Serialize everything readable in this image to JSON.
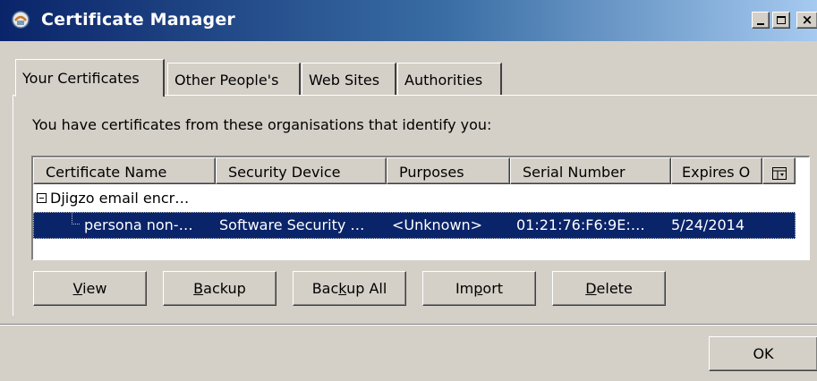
{
  "window": {
    "title": "Certificate Manager",
    "icon": "certificate-manager-app-icon"
  },
  "tabs": [
    {
      "label": "Your Certificates",
      "active": true
    },
    {
      "label": "Other People's",
      "active": false
    },
    {
      "label": "Web Sites",
      "active": false
    },
    {
      "label": "Authorities",
      "active": false
    }
  ],
  "intro_text": "You have certificates from these organisations that identify you:",
  "table": {
    "columns": [
      "Certificate Name",
      "Security Device",
      "Purposes",
      "Serial Number",
      "Expires O"
    ],
    "column_picker_icon": "column-picker-icon",
    "rows": [
      {
        "type": "group",
        "expanded": true,
        "name": "Djigzo email encr…"
      },
      {
        "type": "item",
        "selected": true,
        "name": "persona non-…",
        "device": "Software Security …",
        "purposes": "<Unknown>",
        "serial": "01:21:76:F6:9E:…",
        "expires": "5/24/2014"
      }
    ]
  },
  "buttons": {
    "view": {
      "pre": "",
      "key": "V",
      "post": "iew"
    },
    "backup": {
      "pre": "",
      "key": "B",
      "post": "ackup"
    },
    "backup_all": {
      "pre": "Bac",
      "key": "k",
      "post": "up All"
    },
    "import": {
      "pre": "Im",
      "key": "p",
      "post": "ort"
    },
    "delete": {
      "pre": "",
      "key": "D",
      "post": "elete"
    },
    "ok": "OK"
  },
  "colors": {
    "selection": "#0a246a",
    "face": "#d4d0c8"
  }
}
